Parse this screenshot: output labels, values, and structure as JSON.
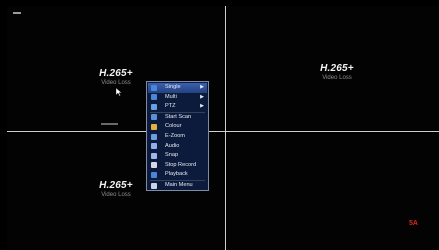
{
  "channels": [
    {
      "codec": "H.265+",
      "status": "Video Loss"
    },
    {
      "codec": "H.265+",
      "status": "Video Loss"
    },
    {
      "codec": "H.265+",
      "status": "Video Loss"
    }
  ],
  "status_indicator": "5A",
  "menu": {
    "items": [
      {
        "label": "Single",
        "icon": "single-view-icon",
        "submenu": true
      },
      {
        "label": "Multi",
        "icon": "multi-view-icon",
        "submenu": true
      },
      {
        "label": "PTZ",
        "icon": "ptz-icon",
        "submenu": true
      },
      {
        "label": "Start Scan",
        "icon": "scan-icon",
        "submenu": false
      },
      {
        "label": "Colour",
        "icon": "colour-icon",
        "submenu": false
      },
      {
        "label": "E-Zoom",
        "icon": "zoom-icon",
        "submenu": false
      },
      {
        "label": "Audio",
        "icon": "audio-icon",
        "submenu": false
      },
      {
        "label": "Snap",
        "icon": "snap-icon",
        "submenu": false
      },
      {
        "label": "Stop Record",
        "icon": "record-icon",
        "submenu": false
      },
      {
        "label": "Playback",
        "icon": "playback-icon",
        "submenu": false
      },
      {
        "label": "Main Menu",
        "icon": "main-menu-icon",
        "submenu": false
      }
    ],
    "submenu_arrow": "▶"
  },
  "colors": {
    "menu_bg": "#0c1a3c",
    "highlight": "#3a5fb0",
    "status_red": "#d9261c"
  }
}
